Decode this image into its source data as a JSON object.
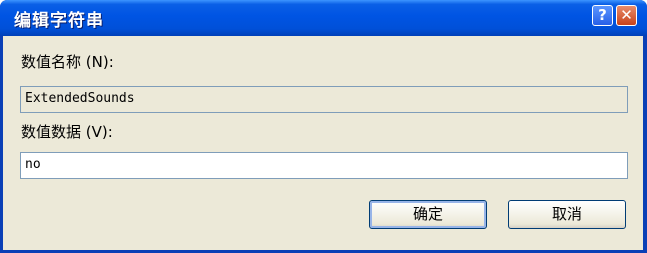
{
  "window": {
    "title": "编辑字符串",
    "help_label": "?",
    "close_label": "✕"
  },
  "form": {
    "value_name_label": "数值名称 (N):",
    "value_name": "ExtendedSounds",
    "value_data_label": "数值数据 (V):",
    "value_data": "no"
  },
  "buttons": {
    "ok_label": "确定",
    "cancel_label": "取消"
  },
  "colors": {
    "titlebar": "#0054e3",
    "dialog_background": "#ece9d8",
    "close_button": "#c8421c"
  }
}
